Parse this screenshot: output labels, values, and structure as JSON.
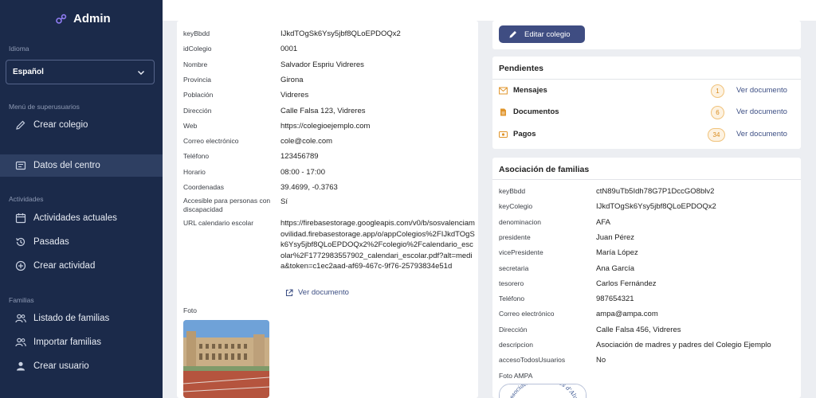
{
  "app": {
    "title": "Admin"
  },
  "sidebar": {
    "language_section": "Idioma",
    "language_value": "Español",
    "superuser_section": "Menú de superusuarios",
    "create_school": "Crear colegio",
    "school_data": "Datos del centro",
    "activities_section": "Actividades",
    "current_activities": "Actividades actuales",
    "past_activities": "Pasadas",
    "create_activity": "Crear actividad",
    "families_section": "Familias",
    "family_list": "Listado de familias",
    "import_families": "Importar familias",
    "create_user": "Crear usuario"
  },
  "school": {
    "fields": [
      {
        "label": "keyBbdd",
        "value": "IJkdTOgSk6Ysy5jbf8QLoEPDOQx2"
      },
      {
        "label": "idColegio",
        "value": "0001"
      },
      {
        "label": "Nombre",
        "value": "Salvador Espriu Vidreres"
      },
      {
        "label": "Provincia",
        "value": "Girona"
      },
      {
        "label": "Población",
        "value": "Vidreres"
      },
      {
        "label": "Dirección",
        "value": "Calle Falsa 123, Vidreres"
      },
      {
        "label": "Web",
        "value": "https://colegioejemplo.com"
      },
      {
        "label": "Correo electrónico",
        "value": "cole@cole.com"
      },
      {
        "label": "Teléfono",
        "value": "123456789"
      },
      {
        "label": "Horario",
        "value": "08:00 - 17:00"
      },
      {
        "label": "Coordenadas",
        "value": "39.4699, -0.3763"
      }
    ],
    "accessible_label_1": "Accesible para personas con",
    "accessible_label_2": "discapacidad",
    "accessible_value": "Sí",
    "calendar_label": "URL calendario escolar",
    "calendar_url": "https://firebasestorage.googleapis.com/v0/b/sosvalenciamovilidad.firebasestorage.app/o/appColegios%2FIJkdTOgSk6Ysy5jbf8QLoEPDOQx2%2Fcolegio%2Fcalendario_escolar%2F1772983557902_calendari_escolar.pdf?alt=media&token=c1ec2aad-af69-467c-9f76-25793834e51d",
    "view_document": "Ver documento",
    "photo_label": "Foto"
  },
  "edit": {
    "label": "Editar colegio"
  },
  "pending": {
    "title": "Pendientes",
    "items": [
      {
        "label": "Mensajes",
        "count": "1",
        "link": "Ver documento",
        "icon": "mail-icon"
      },
      {
        "label": "Documentos",
        "count": "6",
        "link": "Ver documento",
        "icon": "document-icon"
      },
      {
        "label": "Pagos",
        "count": "34",
        "link": "Ver documento",
        "icon": "payment-icon"
      }
    ]
  },
  "association": {
    "title": "Asociación de familias",
    "fields": [
      {
        "label": "keyBbdd",
        "value": "ctN89uTb5Idh78G7P1DccGO8blv2"
      },
      {
        "label": "keyColegio",
        "value": "IJkdTOgSk6Ysy5jbf8QLoEPDOQx2"
      },
      {
        "label": "denominacion",
        "value": "AFA"
      },
      {
        "label": "presidente",
        "value": "Juan Pérez"
      },
      {
        "label": "vicePresidente",
        "value": "María López"
      },
      {
        "label": "secretaria",
        "value": "Ana García"
      },
      {
        "label": "tesorero",
        "value": "Carlos Fernández"
      },
      {
        "label": "Teléfono",
        "value": "987654321"
      },
      {
        "label": "Correo electrónico",
        "value": "ampa@ampa.com"
      },
      {
        "label": "Dirección",
        "value": "Calle Falsa 456, Vidreres"
      },
      {
        "label": "descripcion",
        "value": "Asociación de madres y padres del Colegio Ejemplo"
      },
      {
        "label": "accesoTodosUsuarios",
        "value": "No"
      }
    ],
    "photo_label": "Foto AMPA",
    "logo_text": "Associació de Famílies d'Alumnes"
  },
  "colors": {
    "sidebar": "#1b2a4a",
    "accent": "#3f4d82",
    "badge": "#f0c27a"
  }
}
